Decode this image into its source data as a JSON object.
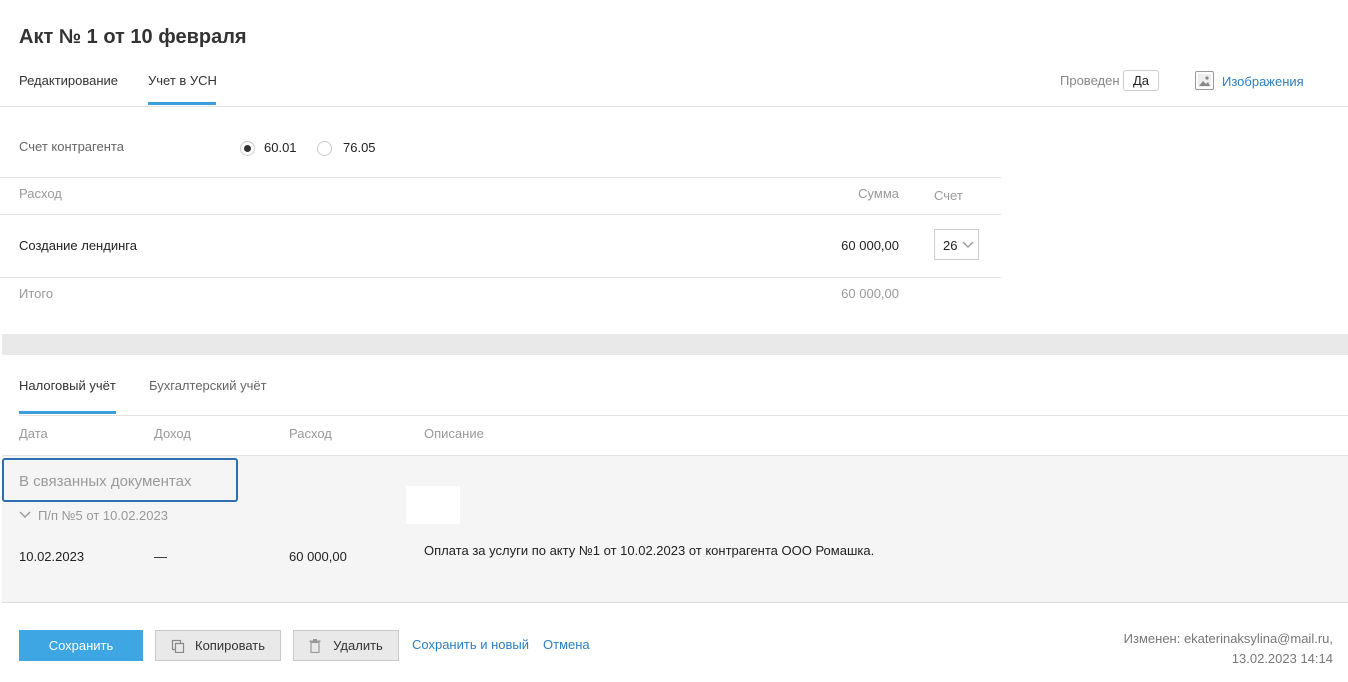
{
  "header": {
    "title": "Акт № 1 от 10 февраля",
    "tabs": [
      "Редактирование",
      "Учет в УСН"
    ],
    "status_label": "Проведен",
    "status_value": "Да",
    "images_link": "Изображения"
  },
  "account": {
    "label": "Счет контрагента",
    "options": [
      "60.01",
      "76.05"
    ],
    "selected": "60.01"
  },
  "expense_table": {
    "headers": {
      "expense": "Расход",
      "amount": "Сумма",
      "account": "Счет"
    },
    "row": {
      "name": "Создание лендинга",
      "amount": "60 000,00",
      "account": "26"
    },
    "total_label": "Итого",
    "total_value": "60 000,00"
  },
  "ledger": {
    "tabs": [
      "Налоговый учёт",
      "Бухгалтерский учёт"
    ],
    "headers": {
      "date": "Дата",
      "income": "Доход",
      "expense": "Расход",
      "description": "Описание"
    },
    "linked_label": "В связанных документах",
    "group_label": "П/п №5 от 10.02.2023",
    "row": {
      "date": "10.02.2023",
      "income": "—",
      "expense": "60 000,00",
      "description": "Оплата за услуги по акту №1 от 10.02.2023 от контрагента ООО Ромашка."
    }
  },
  "footer": {
    "save": "Сохранить",
    "copy": "Копировать",
    "delete": "Удалить",
    "save_new": "Сохранить и новый",
    "cancel": "Отмена",
    "modified_line1": "Изменен: ekaterinaksylina@mail.ru,",
    "modified_line2": "13.02.2023 14:14"
  },
  "colors": {
    "accent": "#3ea6e3",
    "link": "#2b7fc3"
  }
}
